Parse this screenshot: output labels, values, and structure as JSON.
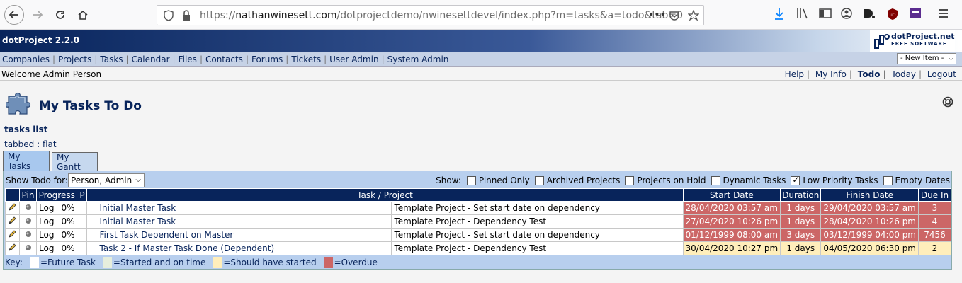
{
  "browser": {
    "url_prefix": "https://",
    "url_host": "nathanwinesett.com",
    "url_path": "/dotprojectdemo/nwinesettdevel/index.php?m=tasks&a=todo&tab=0",
    "more_label": "•••"
  },
  "app": {
    "title": "dotProject 2.2.0",
    "logo_name": "dotProject.net",
    "logo_tagline": "FREE SOFTWARE"
  },
  "menu": [
    "Companies",
    "Projects",
    "Tasks",
    "Calendar",
    "Files",
    "Contacts",
    "Forums",
    "Tickets",
    "User Admin",
    "System Admin"
  ],
  "new_item": "- New Item -",
  "welcome": "Welcome Admin Person",
  "user_links": [
    "Help",
    "My Info",
    "Todo",
    "Today",
    "Logout"
  ],
  "page_title": "My Tasks To Do",
  "subhead": "tasks list",
  "view_links": {
    "tabbed": "tabbed",
    "sep": " : ",
    "flat": "flat"
  },
  "tabs": [
    "My Tasks",
    "My Gantt"
  ],
  "filters": {
    "show_todo_label": "Show Todo for:",
    "person": "Person, Admin",
    "show_label": "Show:",
    "options": [
      {
        "label": "Pinned Only",
        "checked": false
      },
      {
        "label": "Archived Projects",
        "checked": false
      },
      {
        "label": "Projects on Hold",
        "checked": false
      },
      {
        "label": "Dynamic Tasks",
        "checked": false
      },
      {
        "label": "Low Priority Tasks",
        "checked": true
      },
      {
        "label": "Empty Dates",
        "checked": false
      }
    ]
  },
  "table": {
    "headers": [
      "",
      "Pin",
      "Progress",
      "P",
      "Task / Project",
      "Start Date",
      "Duration",
      "Finish Date",
      "Due In"
    ],
    "rows": [
      {
        "log": "Log",
        "progress": "0%",
        "task": "Initial Master Task",
        "project": "Template Project - Set start date on dependency",
        "start": "28/04/2020 03:57 am",
        "duration": "1 days",
        "finish": "29/04/2020 03:57 am",
        "due": "3",
        "status": "overdue"
      },
      {
        "log": "Log",
        "progress": "0%",
        "task": "Initial Master Task",
        "project": "Template Project - Dependency Test",
        "start": "27/04/2020 10:26 pm",
        "duration": "1 days",
        "finish": "28/04/2020 10:26 pm",
        "due": "4",
        "status": "overdue"
      },
      {
        "log": "Log",
        "progress": "0%",
        "task": "First Task Dependent on Master",
        "project": "Template Project - Set start date on dependency",
        "start": "01/12/1999 08:00 am",
        "duration": "3 days",
        "finish": "03/12/1999 04:00 pm",
        "due": "7456",
        "status": "overdue"
      },
      {
        "log": "Log",
        "progress": "0%",
        "task": "Task 2 - If Master Task Done (Dependent)",
        "project": "Template Project - Dependency Test",
        "start": "30/04/2020 10:27 pm",
        "duration": "1 days",
        "finish": "04/05/2020 06:30 pm",
        "due": "2",
        "status": "should"
      }
    ]
  },
  "key": {
    "label": "Key:",
    "items": [
      {
        "label": "=Future Task",
        "color": "#ffffff"
      },
      {
        "label": "=Started and on time",
        "color": "#e6eedd"
      },
      {
        "label": "=Should have started",
        "color": "#ffeebb"
      },
      {
        "label": "=Overdue",
        "color": "#cc6666"
      }
    ]
  }
}
